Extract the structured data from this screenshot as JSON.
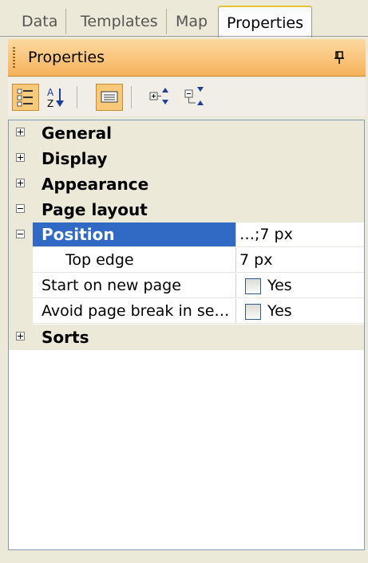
{
  "tabs": [
    {
      "label": "Data"
    },
    {
      "label": "Templates"
    },
    {
      "label": "Map"
    },
    {
      "label": "Properties"
    }
  ],
  "panel": {
    "title": "Properties"
  },
  "toolbar": {
    "buttons": [
      {
        "icon": "categorized-icon",
        "active": true
      },
      {
        "icon": "alphabetical-sort-icon",
        "active": false
      },
      {
        "icon": "property-pages-icon",
        "active": true
      },
      {
        "icon": "expand-all-icon",
        "active": false
      },
      {
        "icon": "collapse-all-icon",
        "active": false
      }
    ]
  },
  "grid": {
    "categories": {
      "general": "General",
      "display": "Display",
      "appearance": "Appearance",
      "page_layout": "Page layout",
      "sorts": "Sorts"
    },
    "position": {
      "label": "Position",
      "value": "…;7 px"
    },
    "top_edge": {
      "label": "Top edge",
      "value": "7 px"
    },
    "start_new_page": {
      "label": "Start on new page",
      "value": "Yes"
    },
    "avoid_break": {
      "label": "Avoid page break in se…",
      "value": "Yes"
    }
  },
  "colors": {
    "selection": "#316ac5",
    "header": "#f7b25a"
  }
}
